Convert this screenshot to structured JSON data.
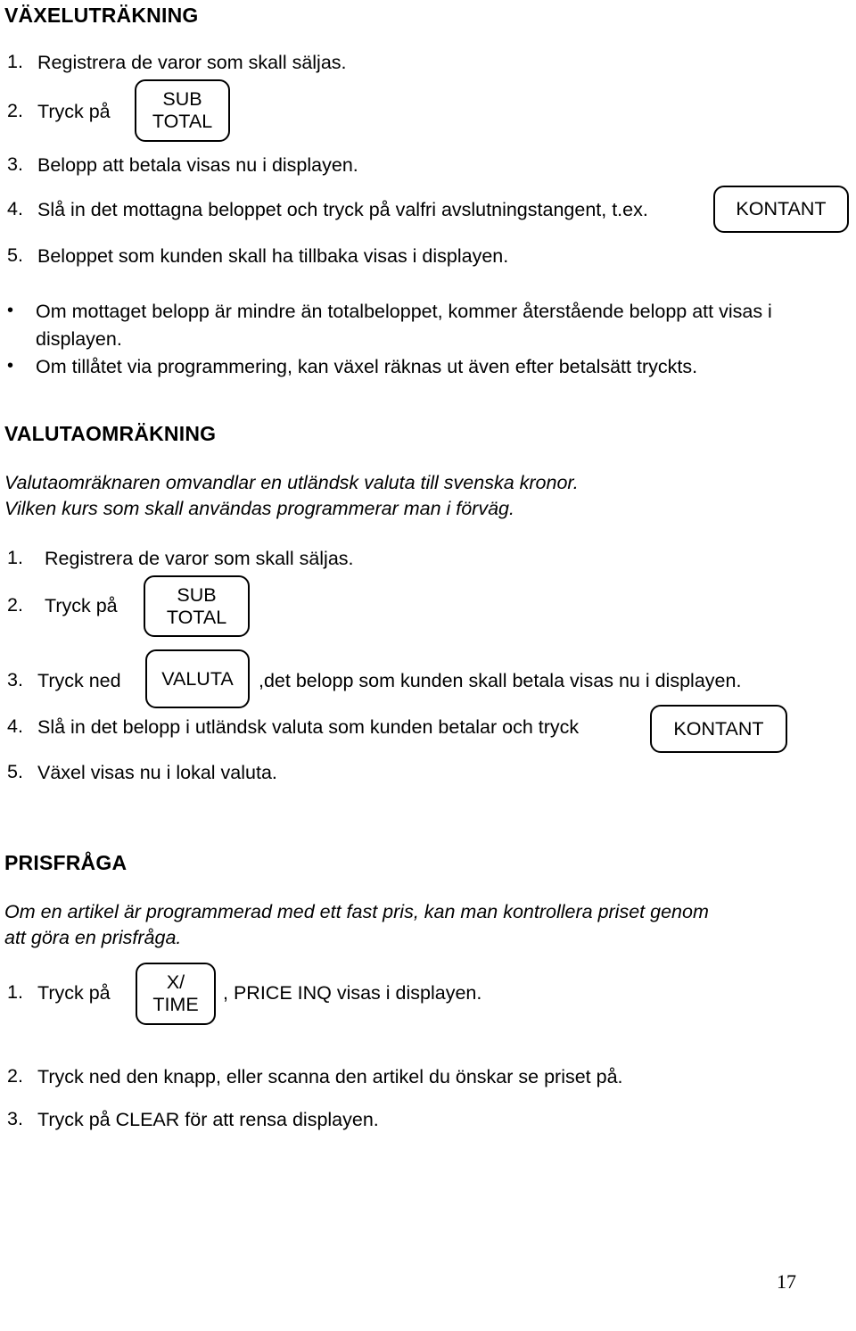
{
  "page": {
    "number": "17"
  },
  "sections": [
    {
      "id": "vaxeluträkning",
      "heading": "VÄXELUTRÄKNING",
      "steps": [
        {
          "num": "1.",
          "text": "Registrera de varor som skall säljas."
        },
        {
          "num": "2.",
          "text": "Tryck på"
        },
        {
          "num": "3.",
          "text": "Belopp att betala visas nu i displayen."
        },
        {
          "num": "4.",
          "text": "Slå in det mottagna beloppet och tryck på valfri avslutningstangent, t.ex."
        },
        {
          "num": "5.",
          "text": "Beloppet som kunden skall ha tillbaka visas i displayen."
        }
      ],
      "bullets": [
        {
          "marker": "•",
          "text": "Om mottaget belopp är mindre än totalbeloppet, kommer återstående belopp att visas i displayen."
        },
        {
          "marker": "•",
          "text": "Om tillåtet via programmering, kan växel räknas ut även efter betalsätt tryckts."
        }
      ],
      "keys": [
        {
          "id": "sub-total-1",
          "lines": [
            "SUB",
            "TOTAL"
          ]
        },
        {
          "id": "kontant-1",
          "lines": [
            "KONTANT"
          ]
        }
      ]
    },
    {
      "id": "valutaomrakning",
      "heading": "VALUTAOMRÄKNING",
      "intro": [
        "Valutaomräknaren omvandlar en utländsk valuta till svenska kronor.",
        "Vilken kurs som skall användas programmerar man i förväg."
      ],
      "steps": [
        {
          "num": "1.",
          "text": "Registrera de varor som skall säljas."
        },
        {
          "num": "2.",
          "text": "Tryck på"
        },
        {
          "num": "3.",
          "text": "Tryck ned",
          "text_after": ",det belopp som kunden skall betala visas nu i displayen."
        },
        {
          "num": "4.",
          "text": "Slå in det belopp i utländsk valuta som kunden betalar och tryck"
        },
        {
          "num": "5.",
          "text": "Växel visas nu i lokal valuta."
        }
      ],
      "keys": [
        {
          "id": "sub-total-2",
          "lines": [
            "SUB",
            "TOTAL"
          ]
        },
        {
          "id": "valuta",
          "lines": [
            "VALUTA"
          ]
        },
        {
          "id": "kontant-2",
          "lines": [
            "KONTANT"
          ]
        }
      ]
    },
    {
      "id": "prisfraga",
      "heading": "PRISFRÅGA",
      "intro": [
        "Om en artikel är programmerad med ett fast pris, kan man kontrollera priset genom",
        "att göra en prisfråga."
      ],
      "steps": [
        {
          "num": "1.",
          "text": "Tryck på",
          "text_after": ", PRICE INQ visas i displayen."
        },
        {
          "num": "2.",
          "text": "Tryck ned den knapp, eller scanna den artikel du önskar se priset på."
        },
        {
          "num": "3.",
          "text": "Tryck på CLEAR för att rensa displayen."
        }
      ],
      "keys": [
        {
          "id": "x-time",
          "lines": [
            "X/",
            "TIME"
          ]
        }
      ]
    }
  ]
}
